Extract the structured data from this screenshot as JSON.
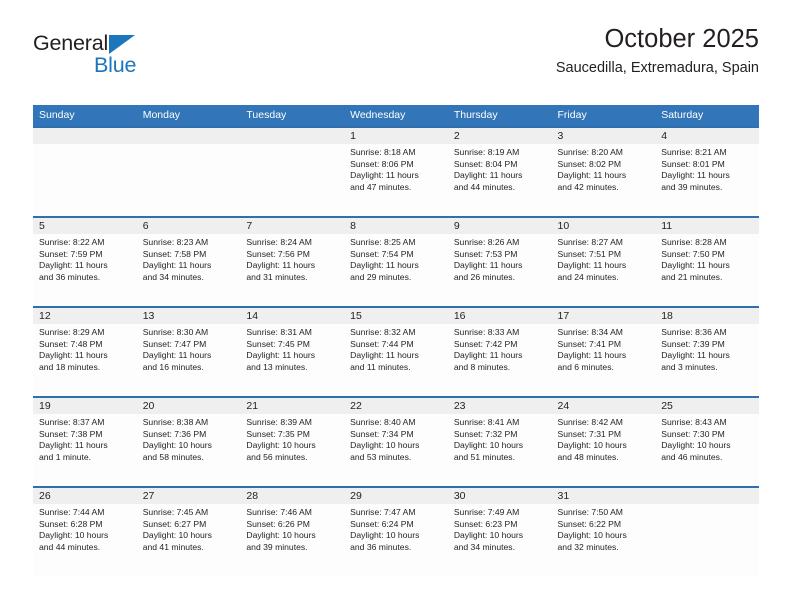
{
  "brand": {
    "name_part1": "General",
    "name_part2": "Blue",
    "triangle_color": "#1b76bc"
  },
  "header": {
    "title": "October 2025",
    "subtitle": "Saucedilla, Extremadura, Spain"
  },
  "calendar": {
    "header_bg": "#3275b8",
    "cell_top_border": "#2f6fad",
    "date_band_bg": "#efefef",
    "weekdays": [
      "Sunday",
      "Monday",
      "Tuesday",
      "Wednesday",
      "Thursday",
      "Friday",
      "Saturday"
    ],
    "weeks": [
      [
        {
          "date": "",
          "lines": []
        },
        {
          "date": "",
          "lines": []
        },
        {
          "date": "",
          "lines": []
        },
        {
          "date": "1",
          "lines": [
            "Sunrise: 8:18 AM",
            "Sunset: 8:06 PM",
            "Daylight: 11 hours",
            "and 47 minutes."
          ]
        },
        {
          "date": "2",
          "lines": [
            "Sunrise: 8:19 AM",
            "Sunset: 8:04 PM",
            "Daylight: 11 hours",
            "and 44 minutes."
          ]
        },
        {
          "date": "3",
          "lines": [
            "Sunrise: 8:20 AM",
            "Sunset: 8:02 PM",
            "Daylight: 11 hours",
            "and 42 minutes."
          ]
        },
        {
          "date": "4",
          "lines": [
            "Sunrise: 8:21 AM",
            "Sunset: 8:01 PM",
            "Daylight: 11 hours",
            "and 39 minutes."
          ]
        }
      ],
      [
        {
          "date": "5",
          "lines": [
            "Sunrise: 8:22 AM",
            "Sunset: 7:59 PM",
            "Daylight: 11 hours",
            "and 36 minutes."
          ]
        },
        {
          "date": "6",
          "lines": [
            "Sunrise: 8:23 AM",
            "Sunset: 7:58 PM",
            "Daylight: 11 hours",
            "and 34 minutes."
          ]
        },
        {
          "date": "7",
          "lines": [
            "Sunrise: 8:24 AM",
            "Sunset: 7:56 PM",
            "Daylight: 11 hours",
            "and 31 minutes."
          ]
        },
        {
          "date": "8",
          "lines": [
            "Sunrise: 8:25 AM",
            "Sunset: 7:54 PM",
            "Daylight: 11 hours",
            "and 29 minutes."
          ]
        },
        {
          "date": "9",
          "lines": [
            "Sunrise: 8:26 AM",
            "Sunset: 7:53 PM",
            "Daylight: 11 hours",
            "and 26 minutes."
          ]
        },
        {
          "date": "10",
          "lines": [
            "Sunrise: 8:27 AM",
            "Sunset: 7:51 PM",
            "Daylight: 11 hours",
            "and 24 minutes."
          ]
        },
        {
          "date": "11",
          "lines": [
            "Sunrise: 8:28 AM",
            "Sunset: 7:50 PM",
            "Daylight: 11 hours",
            "and 21 minutes."
          ]
        }
      ],
      [
        {
          "date": "12",
          "lines": [
            "Sunrise: 8:29 AM",
            "Sunset: 7:48 PM",
            "Daylight: 11 hours",
            "and 18 minutes."
          ]
        },
        {
          "date": "13",
          "lines": [
            "Sunrise: 8:30 AM",
            "Sunset: 7:47 PM",
            "Daylight: 11 hours",
            "and 16 minutes."
          ]
        },
        {
          "date": "14",
          "lines": [
            "Sunrise: 8:31 AM",
            "Sunset: 7:45 PM",
            "Daylight: 11 hours",
            "and 13 minutes."
          ]
        },
        {
          "date": "15",
          "lines": [
            "Sunrise: 8:32 AM",
            "Sunset: 7:44 PM",
            "Daylight: 11 hours",
            "and 11 minutes."
          ]
        },
        {
          "date": "16",
          "lines": [
            "Sunrise: 8:33 AM",
            "Sunset: 7:42 PM",
            "Daylight: 11 hours",
            "and 8 minutes."
          ]
        },
        {
          "date": "17",
          "lines": [
            "Sunrise: 8:34 AM",
            "Sunset: 7:41 PM",
            "Daylight: 11 hours",
            "and 6 minutes."
          ]
        },
        {
          "date": "18",
          "lines": [
            "Sunrise: 8:36 AM",
            "Sunset: 7:39 PM",
            "Daylight: 11 hours",
            "and 3 minutes."
          ]
        }
      ],
      [
        {
          "date": "19",
          "lines": [
            "Sunrise: 8:37 AM",
            "Sunset: 7:38 PM",
            "Daylight: 11 hours",
            "and 1 minute."
          ]
        },
        {
          "date": "20",
          "lines": [
            "Sunrise: 8:38 AM",
            "Sunset: 7:36 PM",
            "Daylight: 10 hours",
            "and 58 minutes."
          ]
        },
        {
          "date": "21",
          "lines": [
            "Sunrise: 8:39 AM",
            "Sunset: 7:35 PM",
            "Daylight: 10 hours",
            "and 56 minutes."
          ]
        },
        {
          "date": "22",
          "lines": [
            "Sunrise: 8:40 AM",
            "Sunset: 7:34 PM",
            "Daylight: 10 hours",
            "and 53 minutes."
          ]
        },
        {
          "date": "23",
          "lines": [
            "Sunrise: 8:41 AM",
            "Sunset: 7:32 PM",
            "Daylight: 10 hours",
            "and 51 minutes."
          ]
        },
        {
          "date": "24",
          "lines": [
            "Sunrise: 8:42 AM",
            "Sunset: 7:31 PM",
            "Daylight: 10 hours",
            "and 48 minutes."
          ]
        },
        {
          "date": "25",
          "lines": [
            "Sunrise: 8:43 AM",
            "Sunset: 7:30 PM",
            "Daylight: 10 hours",
            "and 46 minutes."
          ]
        }
      ],
      [
        {
          "date": "26",
          "lines": [
            "Sunrise: 7:44 AM",
            "Sunset: 6:28 PM",
            "Daylight: 10 hours",
            "and 44 minutes."
          ]
        },
        {
          "date": "27",
          "lines": [
            "Sunrise: 7:45 AM",
            "Sunset: 6:27 PM",
            "Daylight: 10 hours",
            "and 41 minutes."
          ]
        },
        {
          "date": "28",
          "lines": [
            "Sunrise: 7:46 AM",
            "Sunset: 6:26 PM",
            "Daylight: 10 hours",
            "and 39 minutes."
          ]
        },
        {
          "date": "29",
          "lines": [
            "Sunrise: 7:47 AM",
            "Sunset: 6:24 PM",
            "Daylight: 10 hours",
            "and 36 minutes."
          ]
        },
        {
          "date": "30",
          "lines": [
            "Sunrise: 7:49 AM",
            "Sunset: 6:23 PM",
            "Daylight: 10 hours",
            "and 34 minutes."
          ]
        },
        {
          "date": "31",
          "lines": [
            "Sunrise: 7:50 AM",
            "Sunset: 6:22 PM",
            "Daylight: 10 hours",
            "and 32 minutes."
          ]
        },
        {
          "date": "",
          "lines": []
        }
      ]
    ]
  }
}
